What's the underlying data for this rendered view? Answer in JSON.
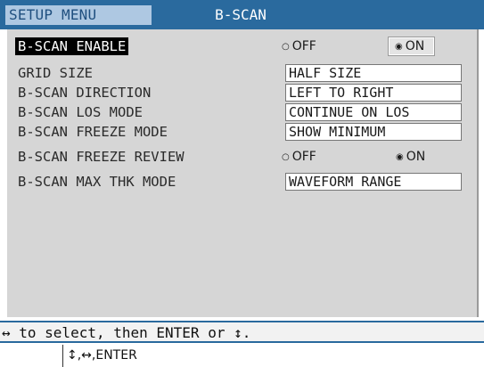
{
  "header": {
    "menu_tab": "SETUP MENU",
    "title": "B-SCAN"
  },
  "settings": {
    "enable": {
      "label": "B-SCAN ENABLE",
      "off": "OFF",
      "on": "ON",
      "selected": "ON"
    },
    "grid_size": {
      "label": "GRID SIZE",
      "value": "HALF SIZE"
    },
    "direction": {
      "label": "B-SCAN DIRECTION",
      "value": "LEFT TO RIGHT"
    },
    "los_mode": {
      "label": "B-SCAN LOS MODE",
      "value": "CONTINUE ON LOS"
    },
    "freeze_mode": {
      "label": "B-SCAN FREEZE MODE",
      "value": "SHOW MINIMUM"
    },
    "freeze_review": {
      "label": "B-SCAN FREEZE REVIEW",
      "off": "OFF",
      "on": "ON",
      "selected": "ON"
    },
    "max_thk_mode": {
      "label": "B-SCAN MAX THK MODE",
      "value": "WAVEFORM RANGE"
    }
  },
  "help": {
    "text": "↔ to select, then ENTER or ↕.",
    "keys": "↕,↔,ENTER"
  },
  "colors": {
    "title_bar": "#2a6a9e",
    "menu_tab_bg": "#aec8e2",
    "panel_bg": "#d6d6d6",
    "selected_label_bg": "#000000"
  }
}
